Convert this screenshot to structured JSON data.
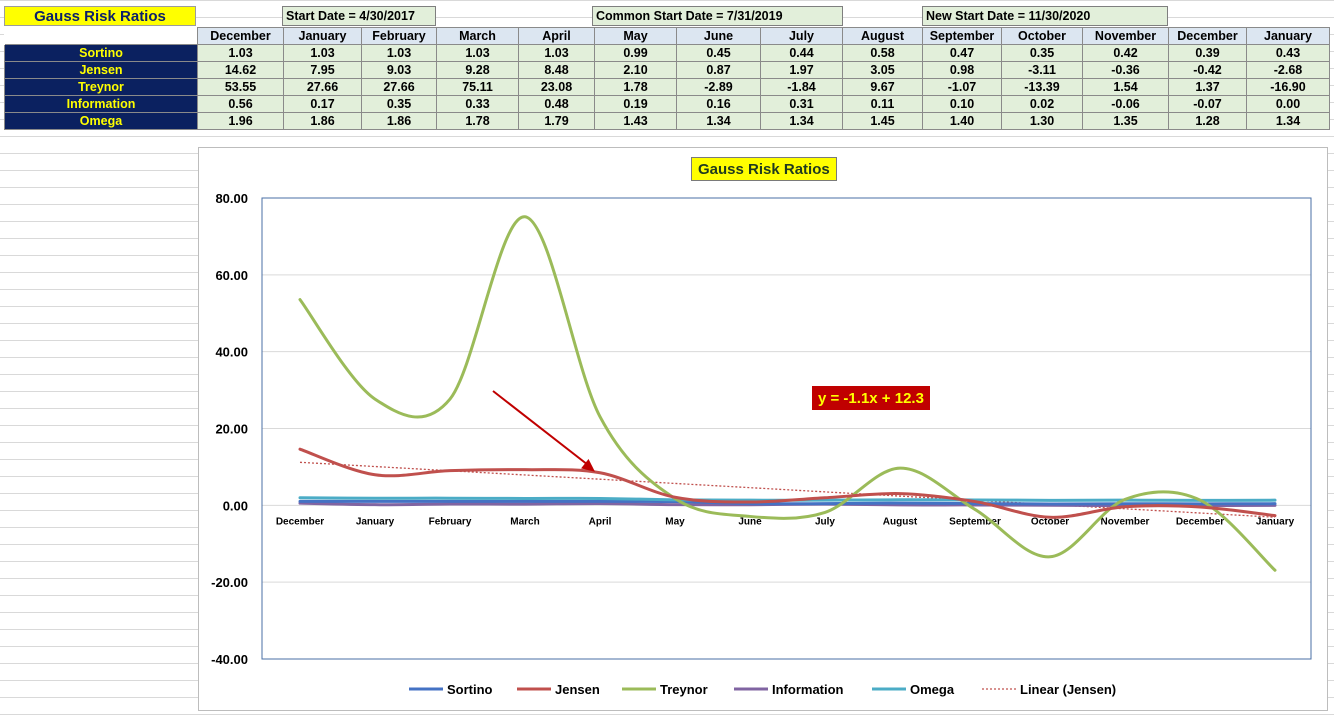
{
  "sheet": {
    "title": "Gauss Risk Ratios",
    "start_date": "Start Date = 4/30/2017",
    "common_start_date": "Common Start Date = 7/31/2019",
    "new_start_date": "New Start Date = 11/30/2020"
  },
  "table": {
    "months": [
      "December",
      "January",
      "February",
      "March",
      "April",
      "May",
      "June",
      "July",
      "August",
      "September",
      "October",
      "November",
      "December",
      "January"
    ],
    "rows": [
      {
        "label": "Sortino",
        "values": [
          "1.03",
          "1.03",
          "1.03",
          "1.03",
          "1.03",
          "0.99",
          "0.45",
          "0.44",
          "0.58",
          "0.47",
          "0.35",
          "0.42",
          "0.39",
          "0.43"
        ]
      },
      {
        "label": "Jensen",
        "values": [
          "14.62",
          "7.95",
          "9.03",
          "9.28",
          "8.48",
          "2.10",
          "0.87",
          "1.97",
          "3.05",
          "0.98",
          "-3.11",
          "-0.36",
          "-0.42",
          "-2.68"
        ]
      },
      {
        "label": "Treynor",
        "values": [
          "53.55",
          "27.66",
          "27.66",
          "75.11",
          "23.08",
          "1.78",
          "-2.89",
          "-1.84",
          "9.67",
          "-1.07",
          "-13.39",
          "1.54",
          "1.37",
          "-16.90"
        ]
      },
      {
        "label": "Information",
        "values": [
          "0.56",
          "0.17",
          "0.35",
          "0.33",
          "0.48",
          "0.19",
          "0.16",
          "0.31",
          "0.11",
          "0.10",
          "0.02",
          "-0.06",
          "-0.07",
          "0.00"
        ]
      },
      {
        "label": "Omega",
        "values": [
          "1.96",
          "1.86",
          "1.86",
          "1.78",
          "1.79",
          "1.43",
          "1.34",
          "1.34",
          "1.45",
          "1.40",
          "1.30",
          "1.35",
          "1.28",
          "1.34"
        ]
      }
    ]
  },
  "chart_data": {
    "type": "line",
    "title": "Gauss Risk Ratios",
    "categories": [
      "December",
      "January",
      "February",
      "March",
      "April",
      "May",
      "June",
      "July",
      "August",
      "September",
      "October",
      "November",
      "December",
      "January"
    ],
    "ylim": [
      -40,
      80
    ],
    "yticks": [
      "80.00",
      "60.00",
      "40.00",
      "20.00",
      "0.00",
      "-20.00",
      "-40.00"
    ],
    "grid": true,
    "legend_position": "bottom",
    "series": [
      {
        "name": "Sortino",
        "color": "#4472c4",
        "values": [
          1.03,
          1.03,
          1.03,
          1.03,
          1.03,
          0.99,
          0.45,
          0.44,
          0.58,
          0.47,
          0.35,
          0.42,
          0.39,
          0.43
        ]
      },
      {
        "name": "Jensen",
        "color": "#c0504d",
        "values": [
          14.62,
          7.95,
          9.03,
          9.28,
          8.48,
          2.1,
          0.87,
          1.97,
          3.05,
          0.98,
          -3.11,
          -0.36,
          -0.42,
          -2.68
        ]
      },
      {
        "name": "Treynor",
        "color": "#9bbb59",
        "values": [
          53.55,
          27.66,
          27.66,
          75.11,
          23.08,
          1.78,
          -2.89,
          -1.84,
          9.67,
          -1.07,
          -13.39,
          1.54,
          1.37,
          -16.9
        ]
      },
      {
        "name": "Information",
        "color": "#8064a2",
        "values": [
          0.56,
          0.17,
          0.35,
          0.33,
          0.48,
          0.19,
          0.16,
          0.31,
          0.11,
          0.1,
          0.02,
          -0.06,
          -0.07,
          0.0
        ]
      },
      {
        "name": "Omega",
        "color": "#4bacc6",
        "values": [
          1.96,
          1.86,
          1.86,
          1.78,
          1.79,
          1.43,
          1.34,
          1.34,
          1.45,
          1.4,
          1.3,
          1.35,
          1.28,
          1.34
        ]
      }
    ],
    "trendline": {
      "name": "Linear (Jensen)",
      "color": "#c0504d",
      "slope": -1.1,
      "intercept": 12.3,
      "label": "y = -1.1x + 12.3"
    },
    "annotation": {
      "type": "arrow",
      "color": "#c00000",
      "target_category": "April",
      "target_series": "Jensen"
    }
  }
}
